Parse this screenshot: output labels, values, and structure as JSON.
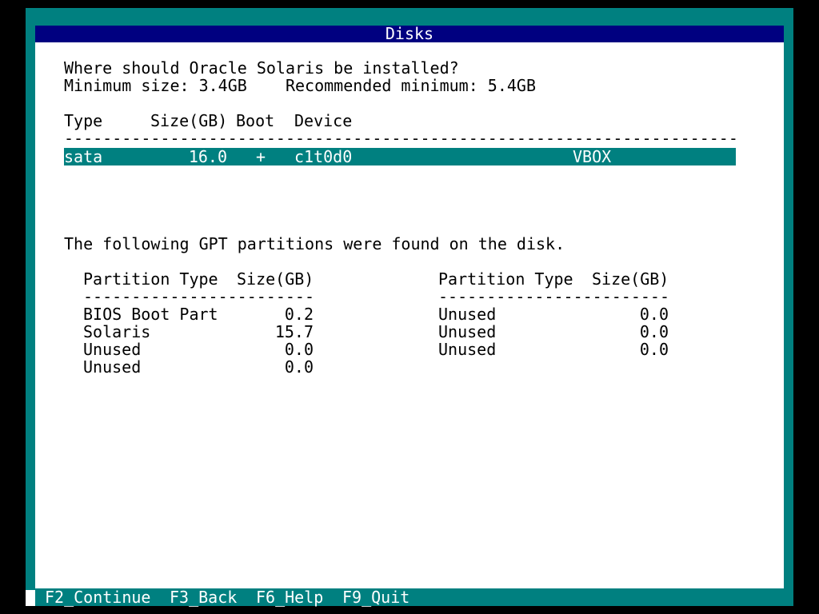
{
  "window": {
    "title": "Disks"
  },
  "prompt": {
    "question": "Where should Oracle Solaris be installed?",
    "sizes": "Minimum size: 3.4GB    Recommended minimum: 5.4GB"
  },
  "disk_table": {
    "headers": {
      "type": "Type",
      "size": "Size(GB)",
      "boot": "Boot",
      "device": "Device"
    },
    "separator": "----------------------------------------------------------------------",
    "rows": [
      {
        "type": "sata",
        "size": "16.0",
        "boot": "+",
        "device": "c1t0d0",
        "vendor": "VBOX"
      }
    ]
  },
  "partitions": {
    "message": "The following GPT partitions were found on the disk.",
    "left": {
      "header_type": "Partition Type",
      "header_size": "Size(GB)",
      "separator": "------------------------",
      "rows": [
        {
          "type": "BIOS Boot Part",
          "size": "0.2"
        },
        {
          "type": "Solaris",
          "size": "15.7"
        },
        {
          "type": "Unused",
          "size": "0.0"
        },
        {
          "type": "Unused",
          "size": "0.0"
        }
      ]
    },
    "right": {
      "header_type": "Partition Type",
      "header_size": "Size(GB)",
      "separator": "------------------------",
      "rows": [
        {
          "type": "Unused",
          "size": "0.0"
        },
        {
          "type": "Unused",
          "size": "0.0"
        },
        {
          "type": "Unused",
          "size": "0.0"
        }
      ]
    }
  },
  "footer": {
    "continue": "F2_Continue",
    "back": "F3_Back",
    "help": "F6_Help",
    "quit": "F9_Quit"
  },
  "colors": {
    "frame": "#008080",
    "title_bar": "#000080",
    "content": "#ffffff",
    "selection": "#008080"
  }
}
